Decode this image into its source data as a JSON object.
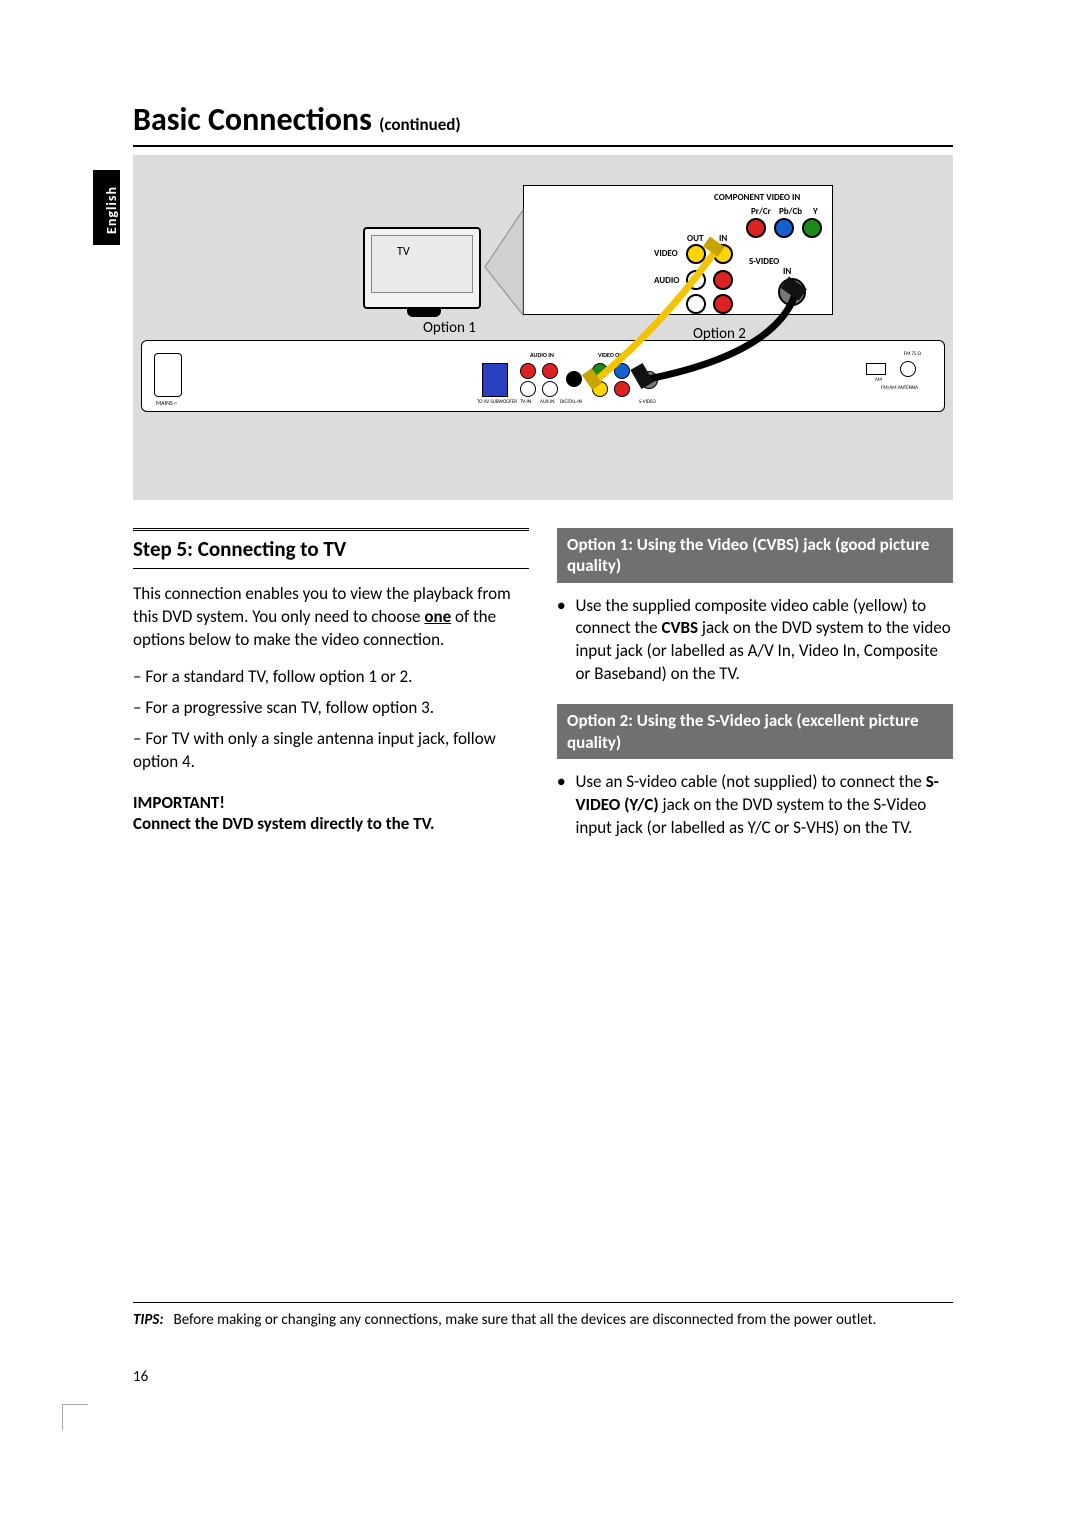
{
  "lang_tab": "English",
  "title_main": "Basic Connections",
  "title_cont": "(continued)",
  "diagram": {
    "tv_label": "TV",
    "option1_label": "Option 1",
    "option2_label": "Option 2",
    "tvback_labels": {
      "component": "COMPONENT VIDEO IN",
      "prcr": "Pr/Cr",
      "pbcb": "Pb/Cb",
      "y": "Y",
      "out": "OUT",
      "in": "IN",
      "video": "VIDEO",
      "audio": "AUDIO",
      "svideo": "S-VIDEO",
      "svideo_in": "IN"
    },
    "device_labels": {
      "audio_in": "AUDIO IN",
      "video_out": "VIDEO OUT",
      "to_av_sub": "TO AV SUBWOOFER",
      "tv_in": "TV-IN",
      "aux_in": "AUX-IN",
      "digital_in": "DIGITAL-IN",
      "fm": "FM 75 Ω",
      "am": "AM",
      "fm_am_antenna": "FM/AM ANTENNA",
      "mains": "MAINS ~",
      "svideo": "S-VIDEO"
    }
  },
  "step_heading": "Step 5:  Connecting to TV",
  "intro_para": "This connection enables you to view the playback from this DVD system. You only need to choose ",
  "intro_one": "one",
  "intro_para2": " of the options below to make the video connection.",
  "dash1": "For a standard TV, follow option 1 or 2.",
  "dash2": "For a progressive scan TV, follow option 3.",
  "dash3": "For TV with only a single antenna input jack, follow option 4.",
  "important_label": "IMPORTANT!",
  "important_text": "Connect the DVD system directly to the TV.",
  "opt1_header": "Option 1: Using the Video (CVBS) jack (good picture quality)",
  "opt1_body_a": "Use the supplied composite video cable (yellow) to connect the ",
  "opt1_cvbs": "CVBS",
  "opt1_body_b": " jack on the DVD system to the video input jack (or labelled as A/V In, Video In, Composite or Baseband) on the TV.",
  "opt2_header": "Option 2: Using the S-Video jack (excellent picture quality)",
  "opt2_body_a": "Use an S-video cable (not supplied) to connect the ",
  "opt2_svideo": "S-VIDEO (Y/C)",
  "opt2_body_b": " jack on the DVD system to the S-Video input jack (or labelled as Y/C or S-VHS) on the TV.",
  "tips_label": "TIPS:",
  "tips_text": "Before making or changing any connections, make sure that all the devices are disconnected from the power outlet.",
  "page_number": "16"
}
